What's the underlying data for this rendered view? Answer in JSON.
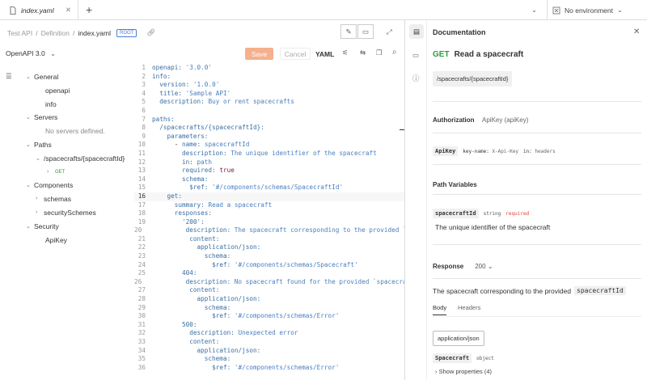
{
  "tab": {
    "title": "index.yaml"
  },
  "env": {
    "label": "No environment"
  },
  "breadcrumb": {
    "items": [
      "Test API",
      "/",
      "Definition",
      "/"
    ],
    "current": "index.yaml",
    "badge": "ROOT"
  },
  "toolbar": {
    "spec": "OpenAPI 3.0",
    "save": "Save",
    "cancel": "Cancel",
    "format": "YAML"
  },
  "tree": {
    "general": "General",
    "openapi": "openapi",
    "info": "info",
    "servers": "Servers",
    "no_servers": "No servers defined.",
    "paths": "Paths",
    "path1": "/spacecrafts/{spacecraftId}",
    "get": "GET",
    "components": "Components",
    "schemas": "schemas",
    "securitySchemes": "securitySchemes",
    "security": "Security",
    "apikey": "ApiKey"
  },
  "code": [
    {
      "n": "1",
      "t": "openapi: '3.0.0'"
    },
    {
      "n": "2",
      "t": "info:"
    },
    {
      "n": "3",
      "t": "  version: '1.0.0'"
    },
    {
      "n": "4",
      "t": "  title: 'Sample API'"
    },
    {
      "n": "5",
      "t": "  description: Buy or rent spacecrafts"
    },
    {
      "n": "6",
      "t": ""
    },
    {
      "n": "7",
      "t": "paths:"
    },
    {
      "n": "8",
      "t": "  /spacecrafts/{spacecraftId}:"
    },
    {
      "n": "9",
      "t": "    parameters:"
    },
    {
      "n": "10",
      "t": "      - name: spacecraftId"
    },
    {
      "n": "11",
      "t": "        description: The unique identifier of the spacecraft"
    },
    {
      "n": "12",
      "t": "        in: path"
    },
    {
      "n": "13",
      "t": "        required: true"
    },
    {
      "n": "14",
      "t": "        schema:"
    },
    {
      "n": "15",
      "t": "          $ref: '#/components/schemas/SpacecraftId'"
    },
    {
      "n": "16",
      "t": "    get:"
    },
    {
      "n": "17",
      "t": "      summary: Read a spacecraft"
    },
    {
      "n": "18",
      "t": "      responses:"
    },
    {
      "n": "19",
      "t": "        '200':"
    },
    {
      "n": "20",
      "t": "          description: The spacecraft corresponding to the provided `s"
    },
    {
      "n": "21",
      "t": "          content:"
    },
    {
      "n": "22",
      "t": "            application/json:"
    },
    {
      "n": "23",
      "t": "              schema:"
    },
    {
      "n": "24",
      "t": "                $ref: '#/components/schemas/Spacecraft'"
    },
    {
      "n": "25",
      "t": "        404:"
    },
    {
      "n": "26",
      "t": "          description: No spacecraft found for the provided `spacecraf"
    },
    {
      "n": "27",
      "t": "          content:"
    },
    {
      "n": "28",
      "t": "            application/json:"
    },
    {
      "n": "29",
      "t": "              schema:"
    },
    {
      "n": "30",
      "t": "                $ref: '#/components/schemas/Error'"
    },
    {
      "n": "31",
      "t": "        500:"
    },
    {
      "n": "32",
      "t": "          description: Unexpected error"
    },
    {
      "n": "33",
      "t": "          content:"
    },
    {
      "n": "34",
      "t": "            application/json:"
    },
    {
      "n": "35",
      "t": "              schema:"
    },
    {
      "n": "36",
      "t": "                $ref: '#/components/schemas/Error'"
    }
  ],
  "doc": {
    "title": "Documentation",
    "method": "GET",
    "summary": "Read a spacecraft",
    "path": "/spacecrafts/{spacecraftId}",
    "auth_label": "Authorization",
    "auth_value": "ApiKey (apiKey)",
    "auth_name": "ApiKey",
    "auth_keyname_label": "key-name:",
    "auth_keyname": "X-Api-Key",
    "auth_in_label": "in:",
    "auth_in": "headers",
    "pathvars": "Path Variables",
    "param_name": "spacecraftId",
    "param_type": "string",
    "param_req": "required",
    "param_desc": "The unique identifier of the spacecraft",
    "response_label": "Response",
    "response_code": "200",
    "response_desc": "The spacecraft corresponding to the provided",
    "response_code_inline": "spacecraftId",
    "tab_body": "Body",
    "tab_headers": "Headers",
    "content_type": "application/json",
    "schema_name": "Spacecraft",
    "schema_type": "object",
    "show_props": "Show properties (4)"
  }
}
